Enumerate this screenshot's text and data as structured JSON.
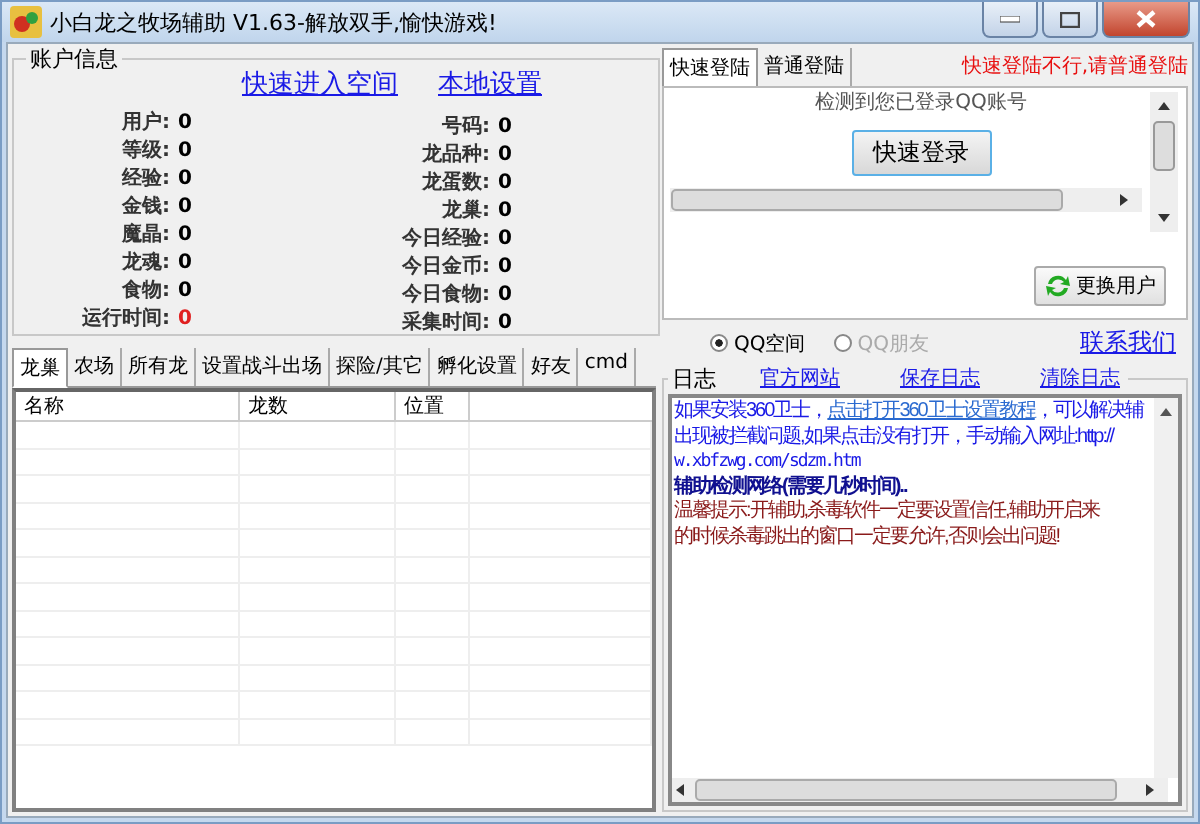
{
  "window": {
    "title": "小白龙之牧场辅助 V1.63-解放双手,愉快游戏!"
  },
  "account": {
    "title": "账户信息",
    "links": [
      "快速进入空间",
      "本地设置"
    ],
    "fields_left": [
      {
        "label": "用户:",
        "value": "0",
        "alert": false
      },
      {
        "label": "等级:",
        "value": "0",
        "alert": false
      },
      {
        "label": "经验:",
        "value": "0",
        "alert": false
      },
      {
        "label": "金钱:",
        "value": "0",
        "alert": false
      },
      {
        "label": "魔晶:",
        "value": "0",
        "alert": false
      },
      {
        "label": "龙魂:",
        "value": "0",
        "alert": false
      },
      {
        "label": "食物:",
        "value": "0",
        "alert": false
      },
      {
        "label": "运行时间:",
        "value": "0",
        "alert": true
      }
    ],
    "fields_right": [
      {
        "label": "号码:",
        "value": "0",
        "alert": false
      },
      {
        "label": "龙品种:",
        "value": "0",
        "alert": false
      },
      {
        "label": "龙蛋数:",
        "value": "0",
        "alert": false
      },
      {
        "label": "龙巢:",
        "value": "0",
        "alert": false
      },
      {
        "label": "今日经验:",
        "value": "0",
        "alert": false
      },
      {
        "label": "今日金币:",
        "value": "0",
        "alert": false
      },
      {
        "label": "今日食物:",
        "value": "0",
        "alert": false
      },
      {
        "label": "采集时间:",
        "value": "0",
        "alert": false
      }
    ]
  },
  "main_tabs": [
    {
      "label": "龙巢",
      "selected": true
    },
    {
      "label": "农场",
      "selected": false
    },
    {
      "label": "所有龙",
      "selected": false
    },
    {
      "label": "设置战斗出场",
      "selected": false
    },
    {
      "label": "探险/其它",
      "selected": false
    },
    {
      "label": "孵化设置",
      "selected": false
    },
    {
      "label": "好友",
      "selected": false
    },
    {
      "label": "cmd",
      "selected": false
    }
  ],
  "table": {
    "columns": [
      "名称",
      "龙数",
      "位置"
    ]
  },
  "login_tabs": [
    {
      "label": "快速登陆",
      "selected": true
    },
    {
      "label": "普通登陆",
      "selected": false
    }
  ],
  "login_hint": "快速登陆不行,请普通登陆",
  "login_panel": {
    "notice": "检测到您已登录QQ账号",
    "login_button": "快速登录",
    "switch_user_button": "更换用户"
  },
  "targets": [
    {
      "label": "QQ空间",
      "selected": true,
      "disabled": false
    },
    {
      "label": "QQ朋友",
      "selected": false,
      "disabled": true
    }
  ],
  "contact_link": "联系我们",
  "log": {
    "title": "日志",
    "links": [
      "官方网站",
      "保存日志",
      "清除日志"
    ],
    "lines": [
      {
        "kind": "info",
        "segments": [
          {
            "text": "如果安装360卫士，",
            "link": false
          },
          {
            "text": "点击打开360卫士设置教程",
            "link": true
          },
          {
            "text": "，可以解决辅",
            "link": false
          }
        ]
      },
      {
        "kind": "info",
        "segments": [
          {
            "text": "出现被拦截问题,如果点击没有打开，手动输入网址:http://",
            "link": false
          }
        ]
      },
      {
        "kind": "url",
        "segments": [
          {
            "text": "w.xbfzwg.com/sdzm.htm",
            "link": false
          }
        ]
      },
      {
        "kind": "status",
        "segments": [
          {
            "text": "辅助检测网络(需要几秒时间)..",
            "link": false
          }
        ]
      },
      {
        "kind": "warning",
        "segments": [
          {
            "text": "温馨提示:开辅助,杀毒软件一定要设置信任,辅助开启来",
            "link": false
          }
        ]
      },
      {
        "kind": "warning",
        "segments": [
          {
            "text": "的时候杀毒跳出的窗口一定要允许,否则会出问题!",
            "link": false
          }
        ]
      }
    ]
  }
}
